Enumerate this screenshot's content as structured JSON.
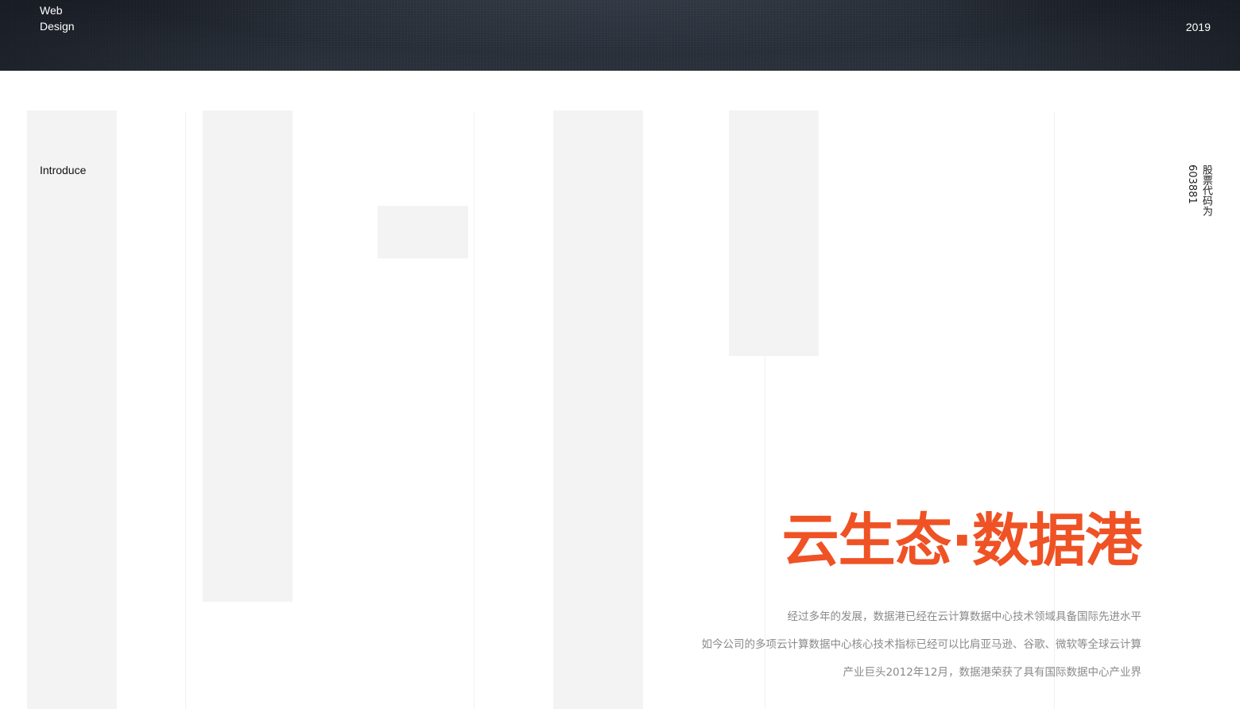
{
  "header": {
    "brand_line1": "Web",
    "brand_line2": "Design",
    "year": "2019"
  },
  "section": {
    "label": "Introduce",
    "stock_label": "股票代码为",
    "stock_code": "603881"
  },
  "hero": {
    "title": "云生态·数据港",
    "accent_color": "#ef5224",
    "paragraphs": [
      "经过多年的发展，数据港已经在云计算数据中心技术领域具备国际先进水平",
      "如今公司的多项云计算数据中心核心技术指标已经可以比肩亚马逊、谷歌、微软等全球云计算",
      "产业巨头2012年12月，数据港荣获了具有国际数据中心产业界"
    ]
  }
}
